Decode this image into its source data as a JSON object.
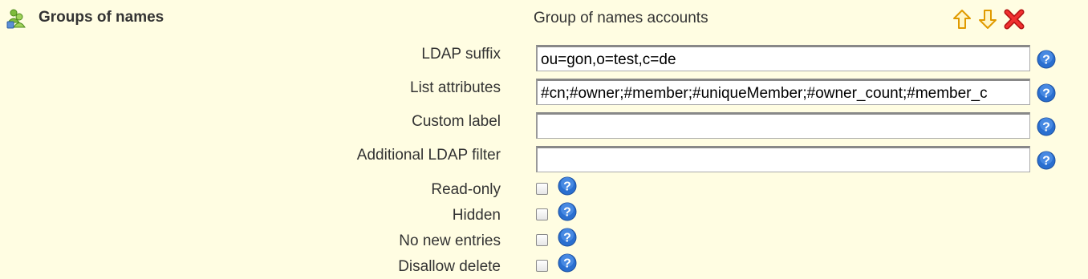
{
  "section": {
    "title": "Groups of names",
    "type_title": "Group of names accounts"
  },
  "toolbar": {
    "move_up_icon": "arrow-up-icon",
    "move_down_icon": "arrow-down-icon",
    "remove_icon": "delete-icon"
  },
  "fields": {
    "ldap_suffix": {
      "label": "LDAP suffix",
      "value": "ou=gon,o=test,c=de"
    },
    "list_attributes": {
      "label": "List attributes",
      "value": "#cn;#owner;#member;#uniqueMember;#owner_count;#member_c"
    },
    "custom_label": {
      "label": "Custom label",
      "value": ""
    },
    "additional_ldap_filter": {
      "label": "Additional LDAP filter",
      "value": ""
    }
  },
  "checkboxes": {
    "read_only": {
      "label": "Read-only",
      "checked": false
    },
    "hidden": {
      "label": "Hidden",
      "checked": false
    },
    "no_new_entries": {
      "label": "No new entries",
      "checked": false
    },
    "disallow_delete": {
      "label": "Disallow delete",
      "checked": false
    }
  },
  "colors": {
    "background": "#fffde2",
    "arrow": "#f0a800",
    "delete": "#e02020",
    "help": "#2a6fd0"
  }
}
